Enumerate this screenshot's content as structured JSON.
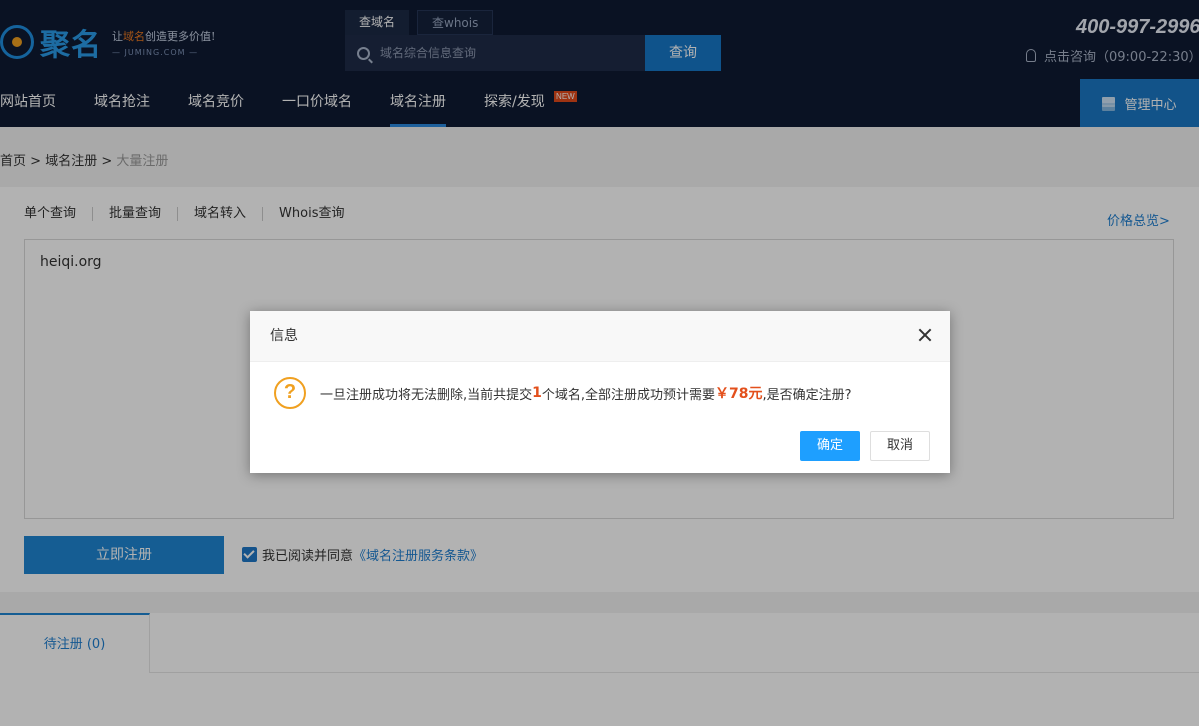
{
  "header": {
    "logo_text": "聚名",
    "slogan_prefix": "让",
    "slogan_highlight": "域名",
    "slogan_suffix": "创造更多价值!",
    "slogan_domain": "— JUMING.COM —",
    "search_tabs": [
      "查域名",
      "查whois"
    ],
    "search_placeholder": "域名综合信息查询",
    "search_button": "查询",
    "phone": "400-997-2996",
    "consult": "点击咨询（09:00-22:30）"
  },
  "nav": {
    "items": [
      "网站首页",
      "域名抢注",
      "域名竞价",
      "一口价域名",
      "域名注册",
      "探索/发现"
    ],
    "new_badge": "NEW",
    "admin": "管理中心"
  },
  "breadcrumb": {
    "home": "首页",
    "sep": ">",
    "section": "域名注册",
    "current": "大量注册"
  },
  "main": {
    "subtabs": [
      "单个查询",
      "批量查询",
      "域名转入",
      "Whois查询"
    ],
    "price_link": "价格总览>",
    "domain_text": "heiqi.org",
    "register_button": "立即注册",
    "agree_text": "我已阅读并同意",
    "agree_link": "《域名注册服务条款》"
  },
  "bottom": {
    "pending_tab": "待注册 (0)"
  },
  "dialog": {
    "title": "信息",
    "msg_part1": "一旦注册成功将无法删除,当前共提交",
    "msg_count": "1",
    "msg_part2": "个域名,全部注册成功预计需要",
    "msg_price": "￥78元",
    "msg_part3": ",是否确定注册?",
    "ok": "确定",
    "cancel": "取消"
  },
  "colors": {
    "header_bg": "#0f1b33",
    "accent": "#1f86d3",
    "dialog_ok": "#1e9fff",
    "highlight": "#e3501c"
  }
}
